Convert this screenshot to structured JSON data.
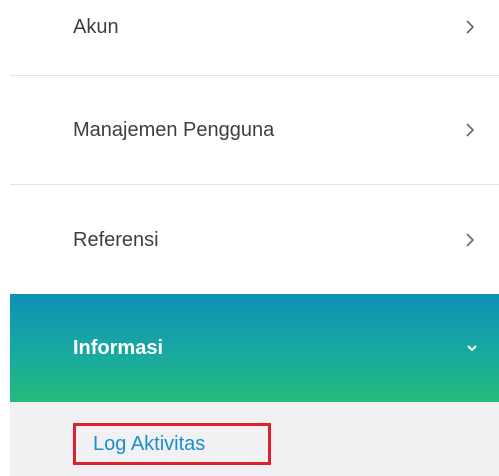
{
  "menu": {
    "items": [
      {
        "label": "Akun"
      },
      {
        "label": "Manajemen Pengguna"
      },
      {
        "label": "Referensi"
      }
    ],
    "active": {
      "label": "Informasi",
      "submenu": [
        {
          "label": "Log Aktivitas"
        }
      ]
    }
  },
  "icons": {
    "collapsed": "chevron-right-icon",
    "expanded": "chevron-down-icon"
  },
  "colors": {
    "active_gradient_top": "#0f90b6",
    "active_gradient_bottom": "#25bb7a",
    "submenu_bg": "#f1f1f3",
    "sublink_text": "#1b8fc8",
    "highlight_border": "#e0202a"
  }
}
